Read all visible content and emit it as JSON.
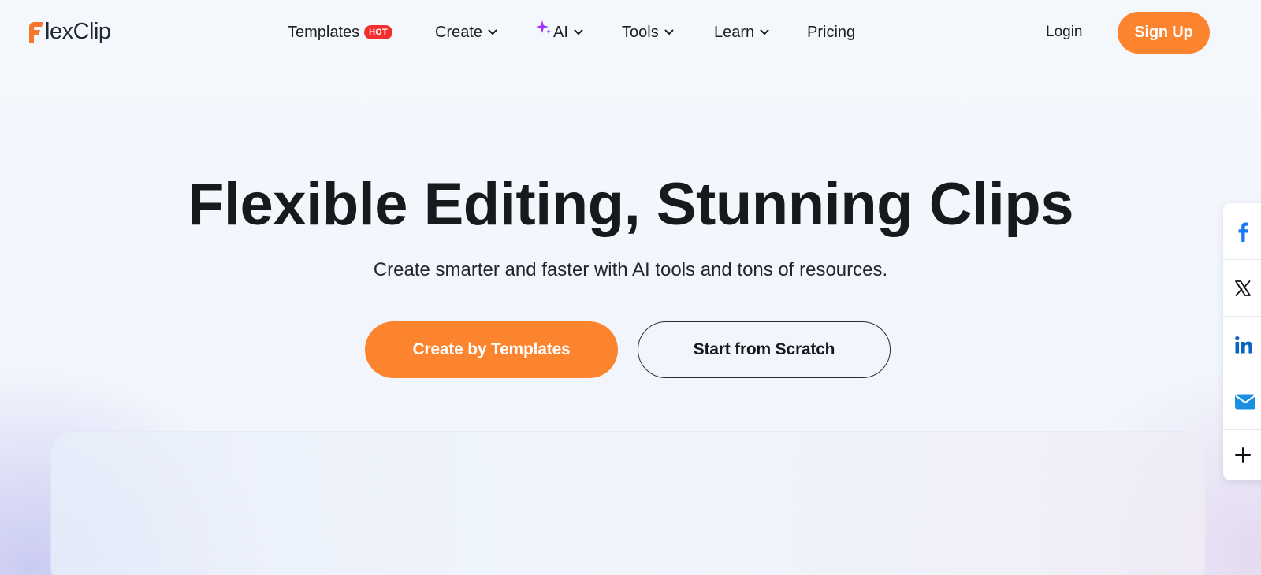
{
  "brand": {
    "logo_text": "lexClip",
    "logo_initial": "F",
    "accent_color": "#fd842f",
    "logo_accent_color": "#f5772b"
  },
  "nav": {
    "items": [
      {
        "label": "Templates",
        "badge": "HOT"
      },
      {
        "label": "Create",
        "icon": "chevron-down-icon"
      },
      {
        "label": "AI",
        "prefix_icon": "sparkle-icon",
        "icon": "chevron-down-icon"
      },
      {
        "label": "Tools",
        "icon": "chevron-down-icon"
      },
      {
        "label": "Learn",
        "icon": "chevron-down-icon"
      },
      {
        "label": "Pricing"
      }
    ],
    "login_label": "Login",
    "signup_label": "Sign Up"
  },
  "hero": {
    "title": "Flexible Editing, Stunning Clips",
    "subtitle": "Create smarter and faster with AI tools and tons of resources.",
    "primary_cta": "Create by Templates",
    "secondary_cta": "Start from Scratch"
  },
  "share_bar": {
    "items": [
      {
        "icon": "facebook-icon",
        "color": "#1877f2"
      },
      {
        "icon": "x-twitter-icon",
        "color": "#111111"
      },
      {
        "icon": "linkedin-icon",
        "color": "#0a66c2"
      },
      {
        "icon": "email-icon",
        "color": "#1a8fe0"
      },
      {
        "icon": "plus-icon",
        "color": "#111111"
      }
    ]
  }
}
